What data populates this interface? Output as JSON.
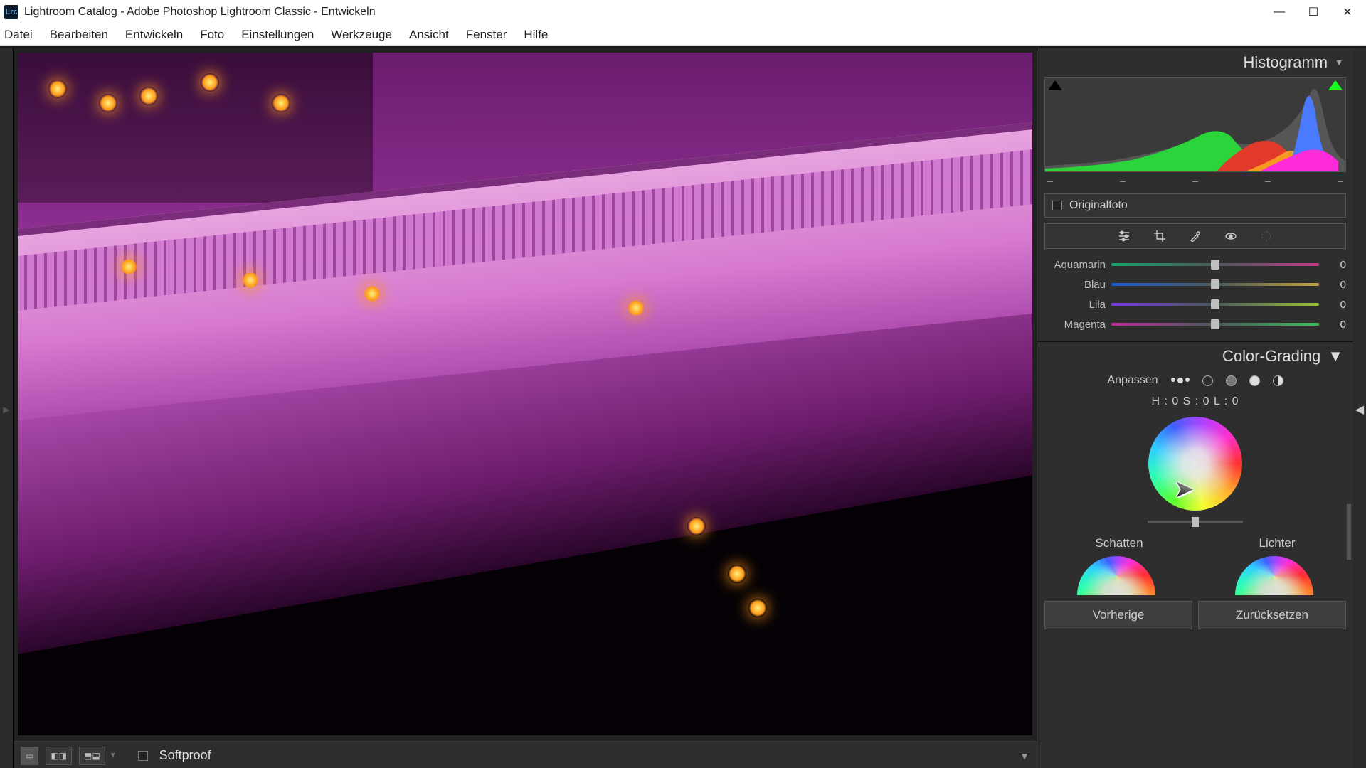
{
  "window": {
    "title": "Lightroom Catalog - Adobe Photoshop Lightroom Classic - Entwickeln",
    "icon_label": "Lrc"
  },
  "menu": {
    "items": [
      "Datei",
      "Bearbeiten",
      "Entwickeln",
      "Foto",
      "Einstellungen",
      "Werkzeuge",
      "Ansicht",
      "Fenster",
      "Hilfe"
    ]
  },
  "footer": {
    "softproof_label": "Softproof"
  },
  "panel": {
    "histogram_label": "Histogramm",
    "axis": [
      "–",
      "–",
      "–",
      "–",
      "–"
    ],
    "original_label": "Originalfoto",
    "sliders": [
      {
        "label": "Aquamarin",
        "value": "0",
        "track": "t-aqua"
      },
      {
        "label": "Blau",
        "value": "0",
        "track": "t-blue"
      },
      {
        "label": "Lila",
        "value": "0",
        "track": "t-lila"
      },
      {
        "label": "Magenta",
        "value": "0",
        "track": "t-mag"
      }
    ],
    "color_grading_label": "Color-Grading",
    "adjust_label": "Anpassen",
    "hsl_readout": "H : 0 S : 0 L : 0",
    "sub_labels": {
      "shadows": "Schatten",
      "highlights": "Lichter"
    },
    "buttons": {
      "prev": "Vorherige",
      "reset": "Zurücksetzen"
    }
  }
}
